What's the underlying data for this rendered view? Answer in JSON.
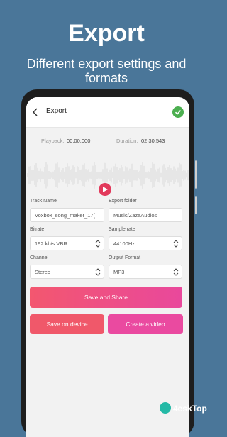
{
  "promo": {
    "headline": "Export",
    "subline": "Different export settings and formats"
  },
  "appbar": {
    "title": "Export"
  },
  "playback": {
    "playback_label": "Playback:",
    "playback_value": "00:00.000",
    "duration_label": "Duration:",
    "duration_value": "02:30.543"
  },
  "fields": {
    "track_name": {
      "label": "Track Name",
      "value": "Voxbox_song_maker_17("
    },
    "export_folder": {
      "label": "Export folder",
      "value": "Music/ZazaAudios"
    },
    "bitrate": {
      "label": "Bitrate",
      "value": "192 kb/s VBR"
    },
    "sample_rate": {
      "label": "Sample rate",
      "value": "44100Hz"
    },
    "channel": {
      "label": "Channel",
      "value": "Stereo"
    },
    "output_format": {
      "label": "Output Format",
      "value": "MP3"
    }
  },
  "buttons": {
    "save_share": "Save and Share",
    "save_device": "Save on device",
    "create_video": "Create a video"
  },
  "watermark": {
    "text": "4eskTop"
  },
  "colors": {
    "background": "#4a7699",
    "accent_red": "#e23a5c",
    "accent_pink": "#ea4aa0",
    "check_green": "#4caf50"
  },
  "icons": [
    "back-arrow-icon",
    "check-circle-icon",
    "play-icon",
    "stepper-icon"
  ]
}
